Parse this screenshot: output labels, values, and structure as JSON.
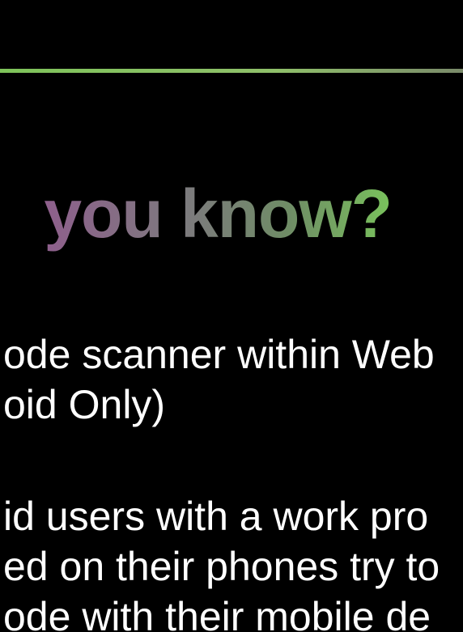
{
  "slide": {
    "headline": "you know?",
    "paragraph_1": {
      "line_1": "ode scanner within Web",
      "line_2": "oid Only)"
    },
    "paragraph_2": {
      "line_1": "id users with a work pro",
      "line_2": "ed on their phones try to",
      "line_3": "ode with their mobile de"
    }
  },
  "colors": {
    "background": "#000000",
    "text": "#ffffff",
    "accent_green": "#79c25c",
    "accent_purple": "#8e5f8c"
  }
}
